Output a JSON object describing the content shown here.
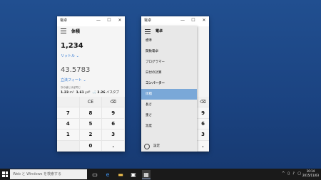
{
  "window1": {
    "title": "電卓",
    "controls": {
      "minimize": "—",
      "maximize": "☐",
      "close": "✕"
    },
    "header": "体積",
    "input_value": "1,234",
    "input_unit": "リットル",
    "output_value": "43.5783",
    "output_unit": "立法フィート",
    "approx_label": "次の値とほぼ同じ",
    "approx": [
      {
        "value": "1.23",
        "unit": "m³"
      },
      {
        "value": "1.61",
        "unit": "yd³"
      },
      {
        "value": "3.26",
        "unit": "バスタブ"
      }
    ],
    "keys": [
      "",
      "CE",
      "⌫",
      "7",
      "8",
      "9",
      "4",
      "5",
      "6",
      "1",
      "2",
      "3",
      "",
      "0",
      "."
    ]
  },
  "window2": {
    "title": "電卓",
    "controls": {
      "minimize": "—",
      "maximize": "☐",
      "close": "✕"
    },
    "menu_header": "電卓",
    "menu_items": [
      {
        "label": "標準"
      },
      {
        "label": "関数電卓"
      },
      {
        "label": "プログラマー"
      },
      {
        "label": "日付の計算"
      }
    ],
    "section": "コンバーター",
    "converter_items": [
      {
        "label": "体積",
        "selected": true
      },
      {
        "label": "長さ"
      },
      {
        "label": "重さ"
      },
      {
        "label": "温度"
      }
    ],
    "settings": "設定",
    "keys_visible": [
      "⌫",
      "9",
      "6",
      "3",
      "."
    ]
  },
  "taskbar": {
    "search_placeholder": "Web と Windows を検索する",
    "clock_time": "10:14",
    "clock_date": "2015/11/03"
  },
  "colors": {
    "accent": "#7aa8d8",
    "link": "#1c6bd0",
    "desktop": "#1e4a8a"
  }
}
